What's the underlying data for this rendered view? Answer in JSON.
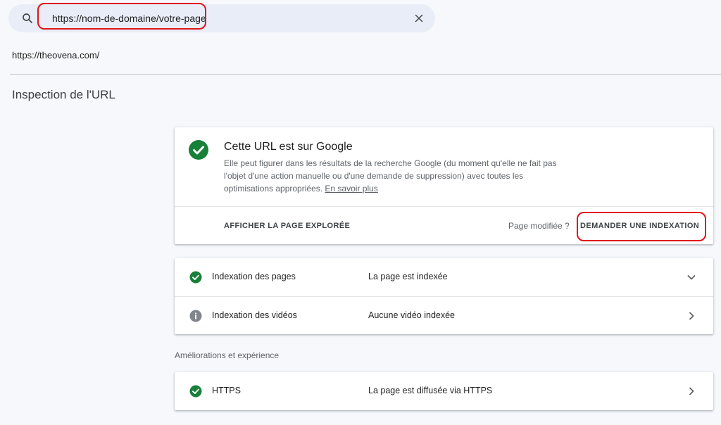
{
  "search": {
    "placeholder": "https://nom-de-domaine/votre-page"
  },
  "property": "https://theovena.com/",
  "page_title": "Inspection de l'URL",
  "status": {
    "title": "Cette URL est sur Google",
    "description": "Elle peut figurer dans les résultats de la recherche Google (du moment qu'elle ne fait pas l'objet d'une action manuelle ou d'une demande de suppression) avec toutes les optimisations appropriées.",
    "learn_more": "En savoir plus",
    "view_crawled_label": "AFFICHER LA PAGE EXPLORÉE",
    "page_modified_label": "Page modifiée ?",
    "request_indexing_label": "DEMANDER UNE INDEXATION"
  },
  "coverage": {
    "rows": [
      {
        "label": "Indexation des pages",
        "value": "La page est indexée",
        "icon": "check-circle-icon",
        "chevron": "chevron-down-icon"
      },
      {
        "label": "Indexation des vidéos",
        "value": "Aucune vidéo indexée",
        "icon": "info-icon",
        "chevron": "chevron-right-icon"
      }
    ]
  },
  "enhancements": {
    "section_label": "Améliorations et expérience",
    "rows": [
      {
        "label": "HTTPS",
        "value": "La page est diffusée via HTTPS",
        "icon": "check-circle-icon",
        "chevron": "chevron-right-icon"
      }
    ]
  },
  "colors": {
    "success_green": "#188038",
    "info_gray": "#80868b",
    "highlight_red": "#e0141b",
    "search_bg": "#e8edf8",
    "page_bg": "#f6f8fc"
  }
}
